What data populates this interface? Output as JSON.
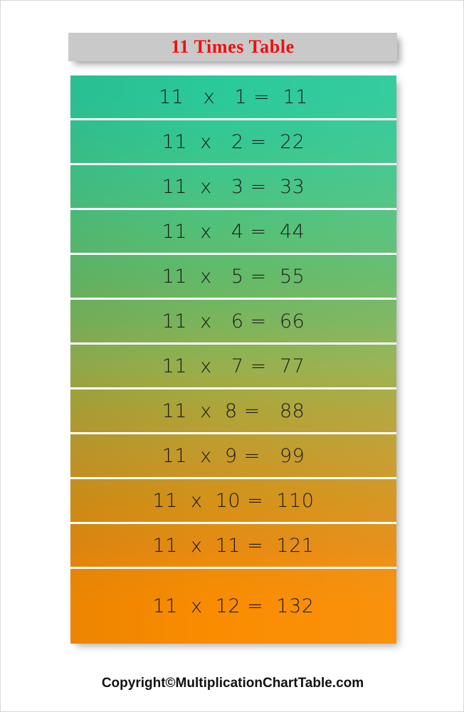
{
  "header": {
    "title": "11 Times Table",
    "title_color": "#f50d0d",
    "banner_color": "#c9c9c9"
  },
  "table": {
    "multiplicand": "11",
    "operator": "x",
    "equals": "=",
    "rows": [
      {
        "expression": "11   x   1 =  11",
        "multiplier": "1",
        "product": "11",
        "color": "#2bc99a"
      },
      {
        "expression": "11  x   2 =  22",
        "multiplier": "2",
        "product": "22",
        "color": "#36c791"
      },
      {
        "expression": "11  x   3 =  33",
        "multiplier": "3",
        "product": "33",
        "color": "#45c486"
      },
      {
        "expression": "11  x   4 =  44",
        "multiplier": "4",
        "product": "44",
        "color": "#54c077"
      },
      {
        "expression": "11  x   5 =  55",
        "multiplier": "5",
        "product": "55",
        "color": "#63ba68"
      },
      {
        "expression": "11  x   6 =  66",
        "multiplier": "6",
        "product": "66",
        "color": "#7bb45c"
      },
      {
        "expression": "11  x   7 =  77",
        "multiplier": "7",
        "product": "77",
        "color": "#97b04d"
      },
      {
        "expression": "11  x  8 =   88",
        "multiplier": "8",
        "product": "88",
        "color": "#afa437"
      },
      {
        "expression": "11  x  9 =   99",
        "multiplier": "9",
        "product": "99",
        "color": "#c49a2a"
      },
      {
        "expression": "11  x  10 =  110",
        "multiplier": "10",
        "product": "110",
        "color": "#d49218"
      },
      {
        "expression": "11  x  11 =  121",
        "multiplier": "11",
        "product": "121",
        "color": "#e58b12"
      },
      {
        "expression": "11  x  12 =  132",
        "multiplier": "12",
        "product": "132",
        "color": "#fa8c00"
      }
    ]
  },
  "footer": {
    "copyright": "Copyright©MultiplicationChartTable.com"
  }
}
